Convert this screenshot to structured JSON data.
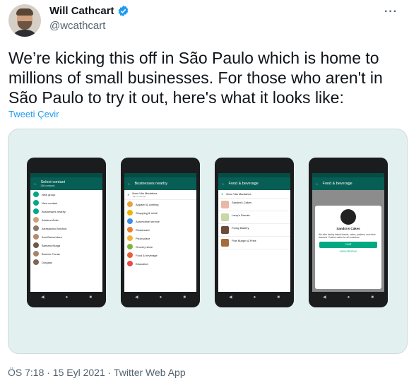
{
  "author": {
    "name": "Will Cathcart",
    "handle": "@wcathcart"
  },
  "tweet": {
    "text": "We’re kicking this off in São Paulo which is home to millions of small businesses.  For those who aren't in São Paulo to try it out, here's what it looks like:",
    "translate": "Tweeti Çevir"
  },
  "phones": [
    {
      "title": "Select contact",
      "subtitle": "256 contacts",
      "rows": [
        "New group",
        "New contact",
        "Businesses nearby",
        "Adriana Ávila",
        "Alessandro Belchior",
        "Ana Boaventura",
        "Bárbara Braga",
        "Benício Ferraz",
        "Douglas"
      ]
    },
    {
      "title": "Businesses nearby",
      "location": "Near Vila Madalena",
      "location_sub": "Tap to change",
      "rows": [
        "Apparel & clothing",
        "Shopping & retail",
        "Automotive service",
        "Restaurant",
        "Pizza place",
        "Grocery store",
        "Food & beverage",
        "Education"
      ]
    },
    {
      "title": "Food & beverage",
      "location": "Near Vila Madalena",
      "items": [
        "Sandra's Cakes",
        "Larry's Donuts",
        "Funky Bakery",
        "Fine Burger & Fries"
      ]
    },
    {
      "title": "Food & beverage",
      "card_name": "Sandra's Cakes",
      "card_text": "We offer freshly baked breads, cakes, pastries, and other desserts. Custom cakes for all occasions.",
      "chat": "CHAT",
      "view": "VIEW PROFILE"
    }
  ],
  "meta": "ÖS 7:18 · 15 Eyl 2021 · Twitter Web App",
  "icons": {
    "verified": "verified-badge-icon",
    "more": "more-icon"
  },
  "colors": {
    "accent": "#1d9bf0",
    "whatsapp": "#075e54"
  }
}
